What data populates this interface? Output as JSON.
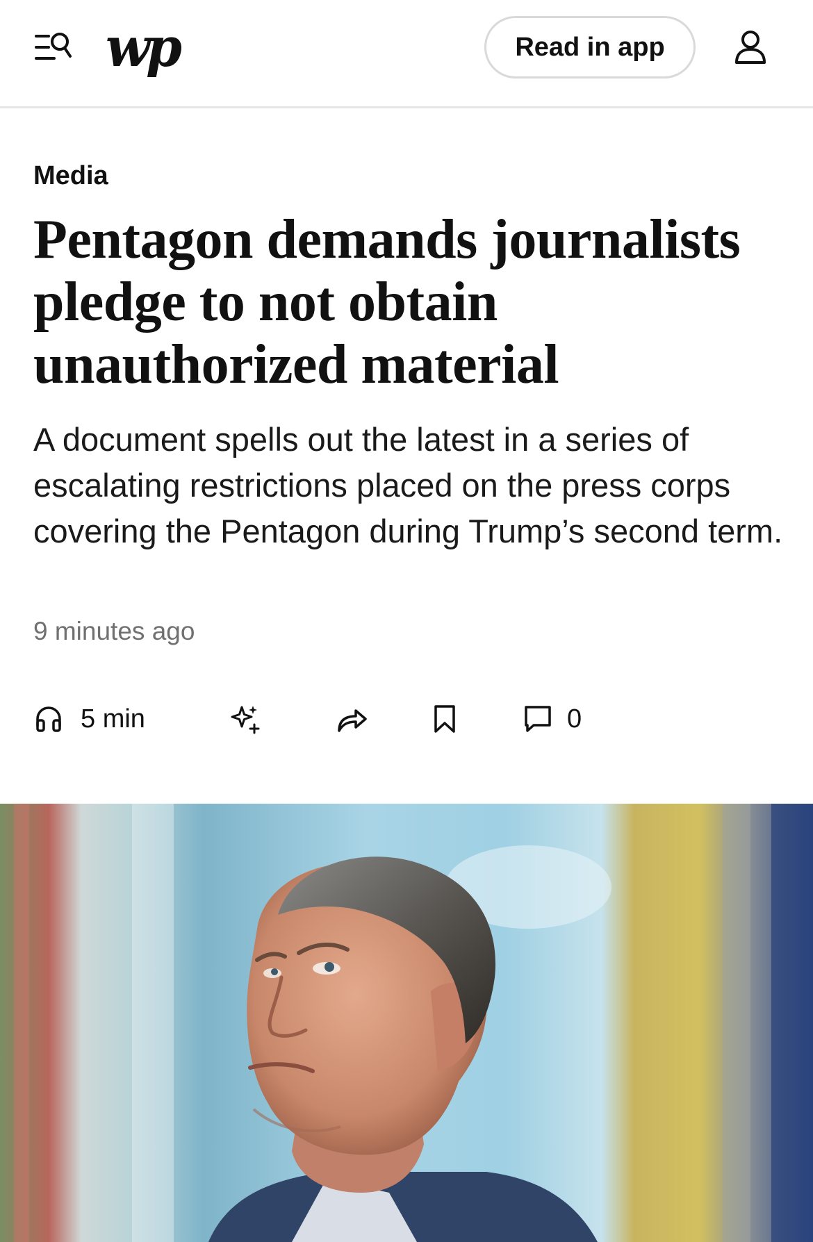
{
  "header": {
    "logo": "wp",
    "read_in_app_label": "Read in app",
    "icons": {
      "menu": "menu-search-icon",
      "account": "user-icon"
    }
  },
  "article": {
    "section": "Media",
    "headline": "Pentagon demands journalists pledge to not obtain unauthorized material",
    "dek": "A document spells out the latest in a series of escalating restrictions placed on the press corps covering the Pentagon during Trump’s second term.",
    "timestamp": "9 minutes ago"
  },
  "actions": {
    "listen_label": "5 min",
    "comments_count": "0",
    "icons": [
      "headphones-icon",
      "sparkle-icon",
      "share-icon",
      "bookmark-icon",
      "comment-icon"
    ]
  },
  "hero_image": {
    "subject": "photo-of-man-looking-up"
  },
  "colors": {
    "text": "#111111",
    "muted": "#707070",
    "border": "#e6e6e6"
  }
}
